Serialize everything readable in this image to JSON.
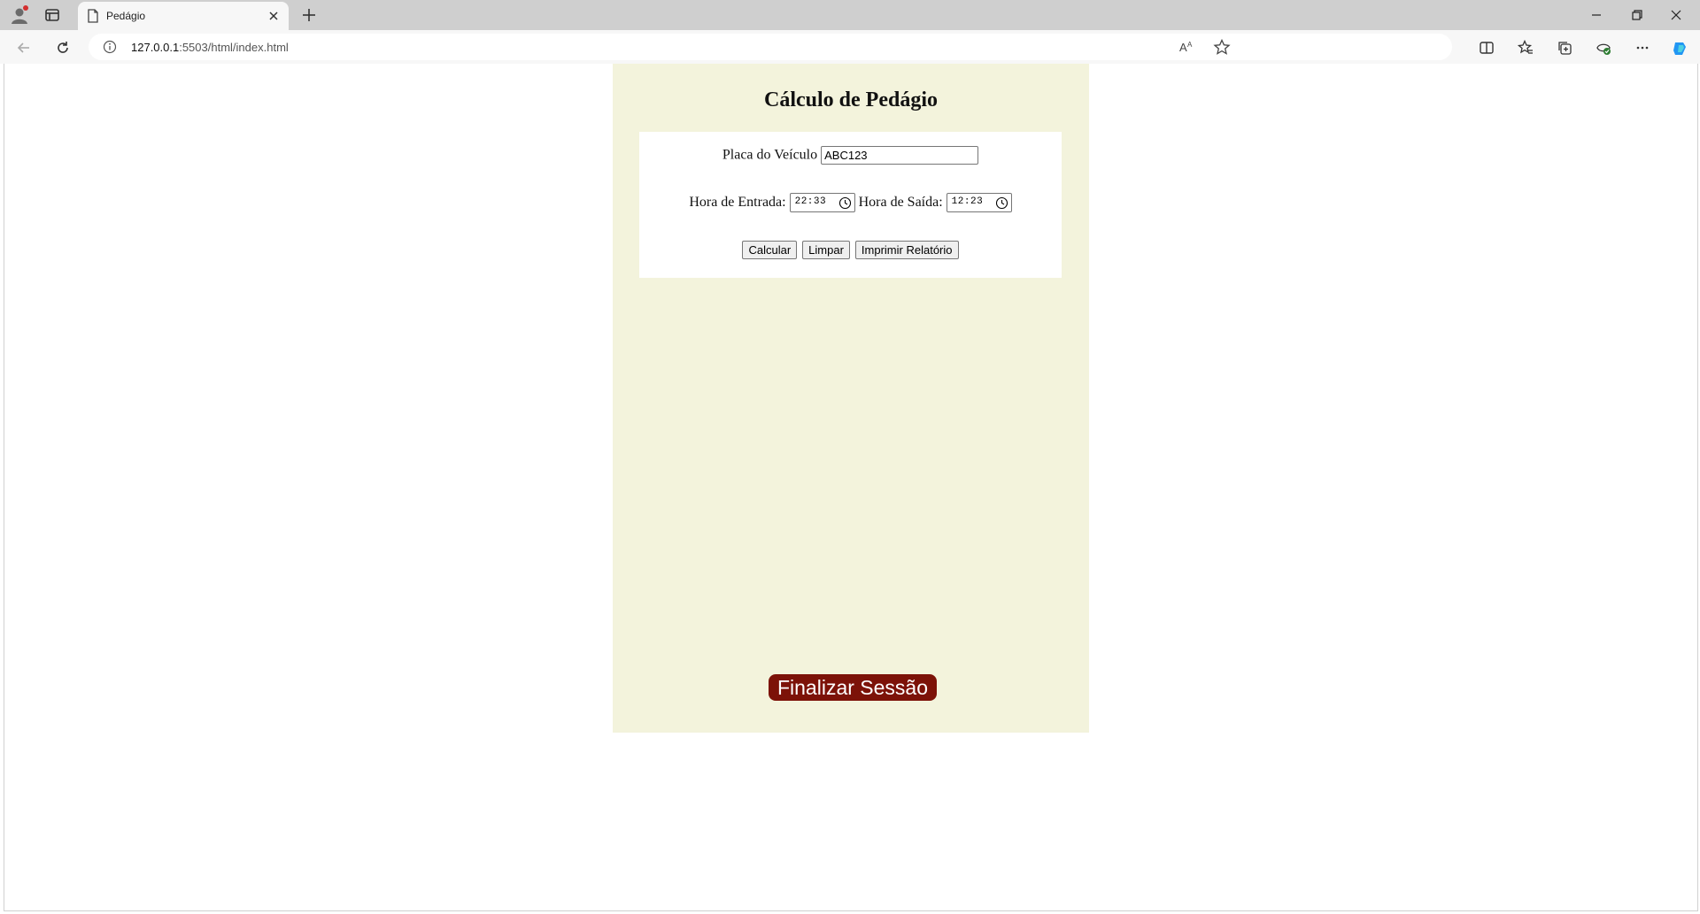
{
  "browser": {
    "tab_title": "Pedágio",
    "url_host": "127.0.0.1",
    "url_path": ":5503/html/index.html"
  },
  "page": {
    "heading": "Cálculo de Pedágio",
    "plate": {
      "label": "Placa do Veículo",
      "value": "ABC123"
    },
    "entry_time": {
      "label": "Hora de Entrada:",
      "value": "22:33"
    },
    "exit_time": {
      "label": "Hora de Saída:",
      "value": "12:23"
    },
    "buttons": {
      "calculate": "Calcular",
      "clear": "Limpar",
      "print_report": "Imprimir Relatório"
    },
    "finish_session": "Finalizar Sessão"
  },
  "colors": {
    "panel_background": "#f3f3dc",
    "finish_button": "#7c1208"
  },
  "icons": [
    "profile-icon",
    "tab-actions-icon",
    "page-icon",
    "close-icon",
    "plus-icon",
    "minimize-icon",
    "restore-icon",
    "window-close-icon",
    "back-icon",
    "refresh-icon",
    "info-icon",
    "read-aloud-icon",
    "favorite-star-icon",
    "split-screen-icon",
    "favorites-icon",
    "collections-icon",
    "browser-essentials-icon",
    "more-icon",
    "copilot-icon",
    "clock-icon"
  ]
}
